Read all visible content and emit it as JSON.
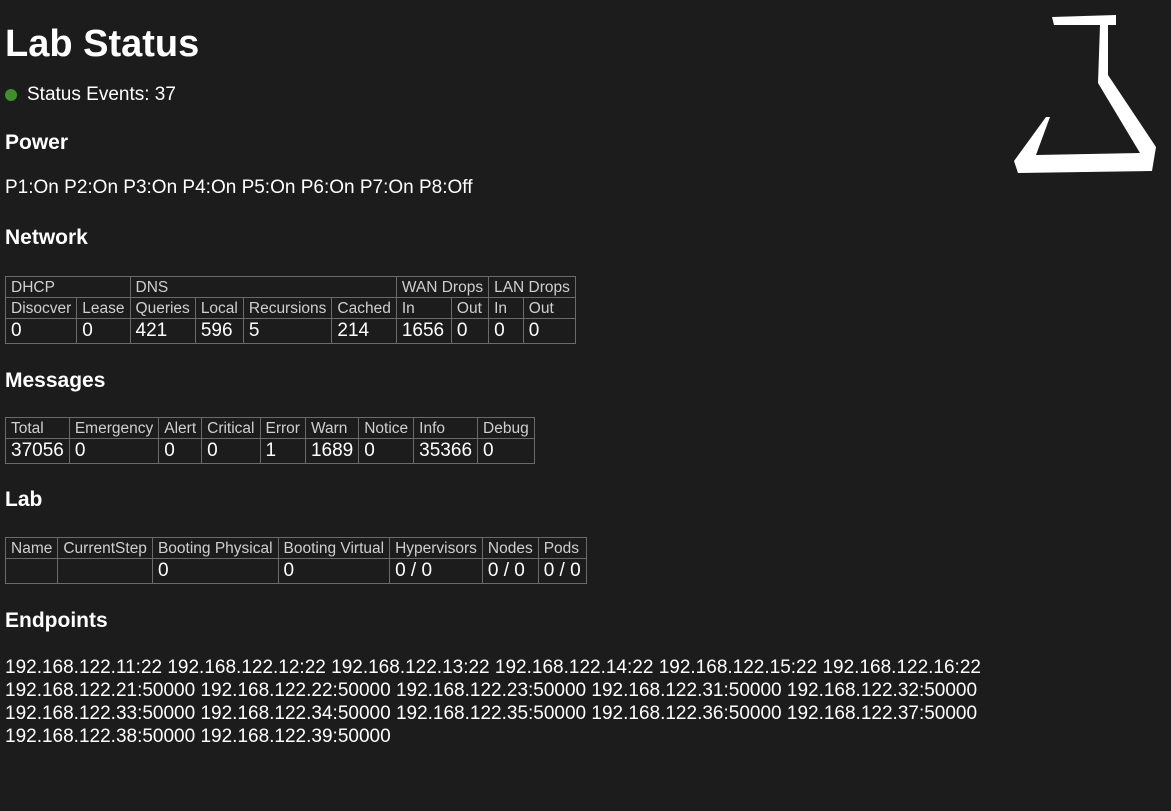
{
  "title": "Lab Status",
  "status": {
    "label": "Status Events: 37",
    "indicator_color": "#3f8f2a",
    "icon": "flask-icon"
  },
  "power": {
    "heading": "Power",
    "text": "P1:On P2:On P3:On P4:On P5:On P6:On P7:On P8:Off"
  },
  "network": {
    "heading": "Network",
    "groups": {
      "dhcp": "DHCP",
      "dns": "DNS",
      "wan_drops": "WAN Drops",
      "lan_drops": "LAN Drops"
    },
    "columns": {
      "discover": "Disocver",
      "lease": "Lease",
      "queries": "Queries",
      "local": "Local",
      "recursions": "Recursions",
      "cached": "Cached",
      "wan_in": "In",
      "wan_out": "Out",
      "lan_in": "In",
      "lan_out": "Out"
    },
    "values": {
      "discover": "0",
      "lease": "0",
      "queries": "421",
      "local": "596",
      "recursions": "5",
      "cached": "214",
      "wan_in": "1656",
      "wan_out": "0",
      "lan_in": "0",
      "lan_out": "0"
    }
  },
  "messages": {
    "heading": "Messages",
    "columns": [
      "Total",
      "Emergency",
      "Alert",
      "Critical",
      "Error",
      "Warn",
      "Notice",
      "Info",
      "Debug"
    ],
    "values": [
      "37056",
      "0",
      "0",
      "0",
      "1",
      "1689",
      "0",
      "35366",
      "0"
    ]
  },
  "lab": {
    "heading": "Lab",
    "columns": [
      "Name",
      "CurrentStep",
      "Booting Physical",
      "Booting Virtual",
      "Hypervisors",
      "Nodes",
      "Pods"
    ],
    "values": [
      "",
      "",
      "0",
      "0",
      "0 / 0",
      "0 / 0",
      "0 / 0"
    ]
  },
  "endpoints": {
    "heading": "Endpoints",
    "items": [
      "192.168.122.11:22",
      "192.168.122.12:22",
      "192.168.122.13:22",
      "192.168.122.14:22",
      "192.168.122.15:22",
      "192.168.122.16:22",
      "192.168.122.21:50000",
      "192.168.122.22:50000",
      "192.168.122.23:50000",
      "192.168.122.31:50000",
      "192.168.122.32:50000",
      "192.168.122.33:50000",
      "192.168.122.34:50000",
      "192.168.122.35:50000",
      "192.168.122.36:50000",
      "192.168.122.37:50000",
      "192.168.122.38:50000",
      "192.168.122.39:50000"
    ]
  }
}
